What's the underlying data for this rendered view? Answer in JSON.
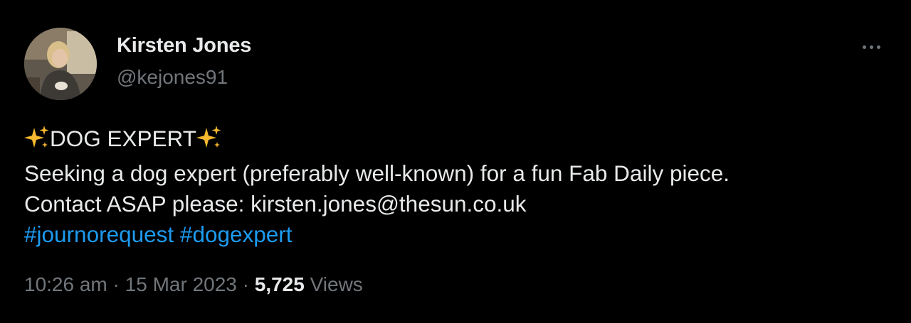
{
  "author": {
    "name": "Kirsten Jones",
    "handle": "@kejones91"
  },
  "menu": {
    "icon": "more-horizontal-icon"
  },
  "tweet": {
    "sparkle_icon": "sparkles-icon",
    "headline": "DOG EXPERT",
    "line2": "Seeking a dog expert (preferably well-known) for a fun Fab Daily piece.",
    "line3": "Contact ASAP please: kirsten.jones@thesun.co.uk",
    "hashtags": [
      "#journorequest",
      "#dogexpert"
    ]
  },
  "meta": {
    "time": "10:26 am",
    "separator": "·",
    "date": "15 Mar 2023",
    "views_count": "5,725",
    "views_label": "Views"
  },
  "colors": {
    "background": "#000000",
    "text": "#e7e9ea",
    "secondary": "#71767b",
    "link": "#1d9bf0",
    "sparkle": "#f5b82e"
  }
}
